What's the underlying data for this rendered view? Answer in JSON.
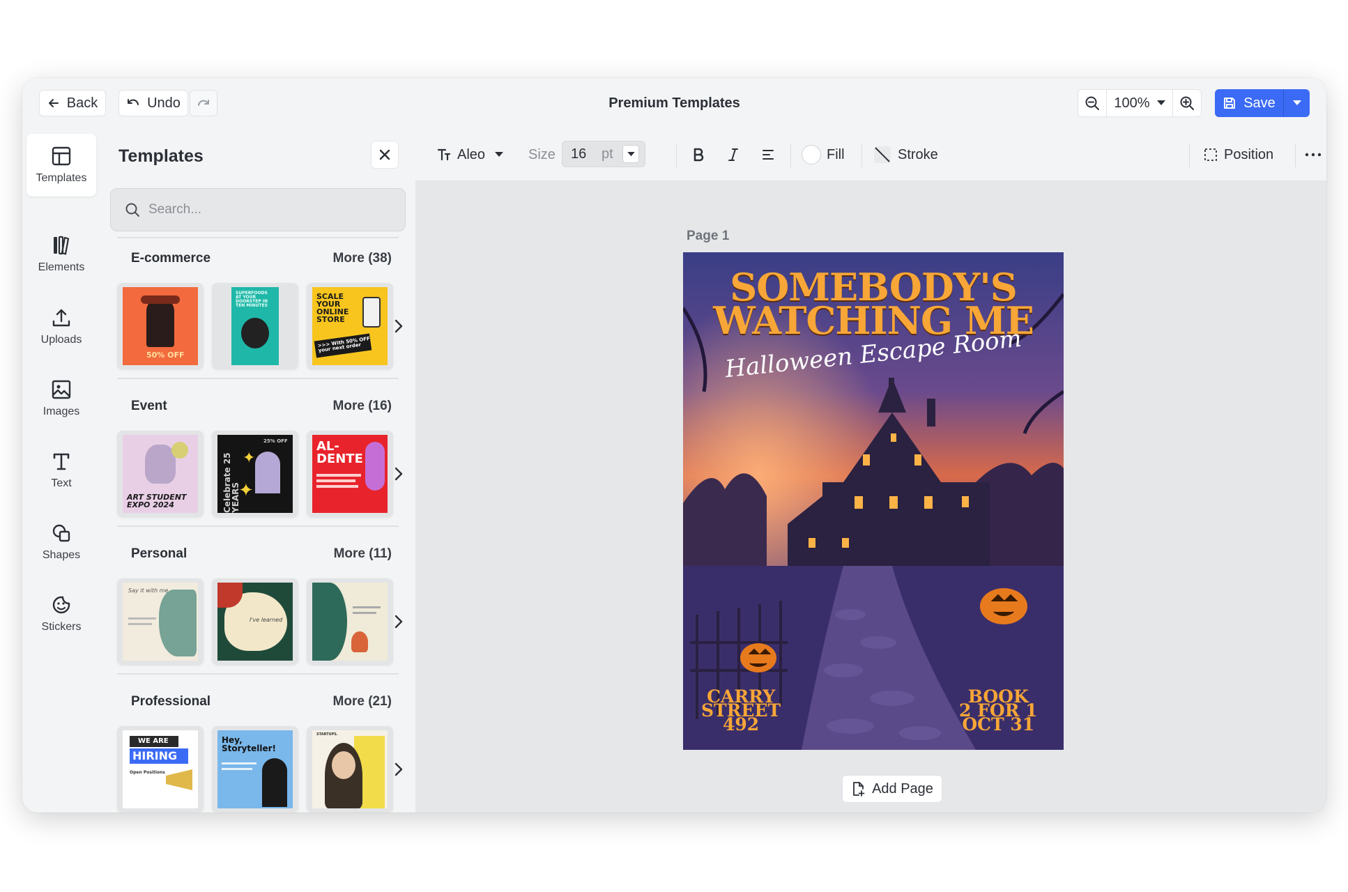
{
  "topbar": {
    "back_label": "Back",
    "undo_label": "Undo",
    "title": "Premium Templates",
    "zoom_value": "100%",
    "save_label": "Save"
  },
  "rail": {
    "items": [
      {
        "label": "Templates"
      },
      {
        "label": "Elements"
      },
      {
        "label": "Uploads"
      },
      {
        "label": "Images"
      },
      {
        "label": "Text"
      },
      {
        "label": "Shapes"
      },
      {
        "label": "Stickers"
      }
    ]
  },
  "panel": {
    "title": "Templates",
    "search_placeholder": "Search...",
    "categories": [
      {
        "name": "E-commerce",
        "more": "More (38)",
        "thumbs": [
          {
            "text": "50% OFF",
            "bg": "#f26a3d"
          },
          {
            "text": "SUPERFOODS AT YOUR DOORSTEP IN TEN MINUTES",
            "bg": "#1fb7a8"
          },
          {
            "text": "SCALE YOUR ONLINE STORE",
            "text2": ">>> With 50% OFF your next order",
            "bg": "#f7c51e"
          }
        ]
      },
      {
        "name": "Event",
        "more": "More (16)",
        "thumbs": [
          {
            "text": "ART STUDENT EXPO 2024",
            "bg": "#e9cfe6"
          },
          {
            "text": "Celebrate 25 YEARS",
            "text2": "25% OFF",
            "bg": "#141414"
          },
          {
            "text": "AL-DENTE",
            "bg": "#e8232b"
          }
        ]
      },
      {
        "name": "Personal",
        "more": "More (11)",
        "thumbs": [
          {
            "text": "Say it with me",
            "bg": "#f2ecde"
          },
          {
            "text": "I've learned",
            "bg": "#f2e7c9"
          },
          {
            "text": "",
            "bg": "#f0ead8"
          }
        ]
      },
      {
        "name": "Professional",
        "more": "More (21)",
        "thumbs": [
          {
            "text": "WE ARE",
            "text2": "HIRING",
            "text3": "Open Positions",
            "bg": "#ffffff"
          },
          {
            "text": "Hey, Storyteller!",
            "bg": "#7ab7ea"
          },
          {
            "text": "STARTUPS.",
            "bg": "#f5f1e6"
          }
        ]
      }
    ]
  },
  "toolbar": {
    "font_name": "Aleo",
    "size_label": "Size",
    "size_value": "16",
    "size_unit": "pt",
    "fill_label": "Fill",
    "stroke_label": "Stroke",
    "position_label": "Position"
  },
  "canvas": {
    "page_label": "Page 1",
    "add_page_label": "Add Page",
    "poster": {
      "title_line1": "SOMEBODY'S",
      "title_line2": "WATCHING ME",
      "subtitle": "Halloween Escape Room",
      "left_line1": "CARRY",
      "left_line2": "STREET",
      "left_line3": "492",
      "right_line1": "BOOK",
      "right_line2": "2 FOR 1",
      "right_line3": "OCT 31"
    }
  },
  "colors": {
    "accent": "#3b6bf5",
    "poster_title": "#f7a637"
  }
}
